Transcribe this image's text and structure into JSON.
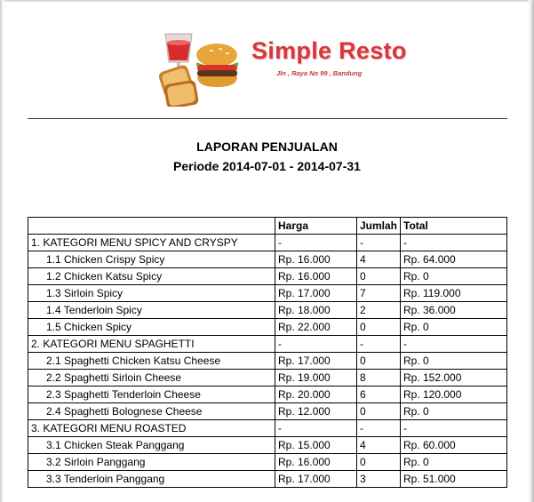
{
  "header": {
    "brand_name": "Simple Resto",
    "address": "Jln , Raya No 99 , Bandung",
    "logo_icon": "food-logo-icon"
  },
  "report": {
    "title": "LAPORAN PENJUALAN",
    "period": "Periode 2014-07-01 - 2014-07-31"
  },
  "table": {
    "columns": [
      "",
      "Harga",
      "Jumlah",
      "Total"
    ],
    "rows": [
      {
        "type": "category",
        "label": "1. KATEGORI MENU SPICY AND CRYSPY",
        "harga": "-",
        "jumlah": "-",
        "total": "-"
      },
      {
        "type": "item",
        "label": "1.1  Chicken Crispy Spicy",
        "harga": "Rp. 16.000",
        "jumlah": "4",
        "total": "Rp. 64.000"
      },
      {
        "type": "item",
        "label": "1.2  Chicken Katsu Spicy",
        "harga": "Rp. 16.000",
        "jumlah": "0",
        "total": "Rp. 0"
      },
      {
        "type": "item",
        "label": "1.3  Sirloin Spicy",
        "harga": "Rp. 17.000",
        "jumlah": "7",
        "total": "Rp. 119.000"
      },
      {
        "type": "item",
        "label": "1.4  Tenderloin Spicy",
        "harga": "Rp. 18.000",
        "jumlah": "2",
        "total": "Rp. 36.000"
      },
      {
        "type": "item",
        "label": "1.5  Chicken Spicy",
        "harga": "Rp. 22.000",
        "jumlah": "0",
        "total": "Rp. 0"
      },
      {
        "type": "category",
        "label": "2. KATEGORI MENU SPAGHETTI",
        "harga": "-",
        "jumlah": "-",
        "total": "-"
      },
      {
        "type": "item",
        "label": "2.1  Spaghetti Chicken Katsu Cheese",
        "harga": "Rp. 17.000",
        "jumlah": "0",
        "total": "Rp. 0"
      },
      {
        "type": "item",
        "label": "2.2  Spaghetti Sirloin Cheese",
        "harga": "Rp. 19.000",
        "jumlah": "8",
        "total": "Rp. 152.000"
      },
      {
        "type": "item",
        "label": "2.3  Spaghetti Tenderloin Cheese",
        "harga": "Rp. 20.000",
        "jumlah": "6",
        "total": "Rp. 120.000"
      },
      {
        "type": "item",
        "label": "2.4  Spaghetti Bolognese Cheese",
        "harga": "Rp. 12.000",
        "jumlah": "0",
        "total": "Rp. 0"
      },
      {
        "type": "category",
        "label": "3. KATEGORI MENU ROASTED",
        "harga": "-",
        "jumlah": "-",
        "total": "-"
      },
      {
        "type": "item",
        "label": "3.1  Chicken Steak Panggang",
        "harga": "Rp. 15.000",
        "jumlah": "4",
        "total": "Rp. 60.000"
      },
      {
        "type": "item",
        "label": "3.2  Sirloin Panggang",
        "harga": "Rp. 16.000",
        "jumlah": "0",
        "total": "Rp. 0"
      },
      {
        "type": "item",
        "label": "3.3  Tenderloin Panggang",
        "harga": "Rp. 17.000",
        "jumlah": "3",
        "total": "Rp. 51.000"
      }
    ]
  },
  "colors": {
    "brand": "#d9363e",
    "rule": "#3a3a3a"
  }
}
